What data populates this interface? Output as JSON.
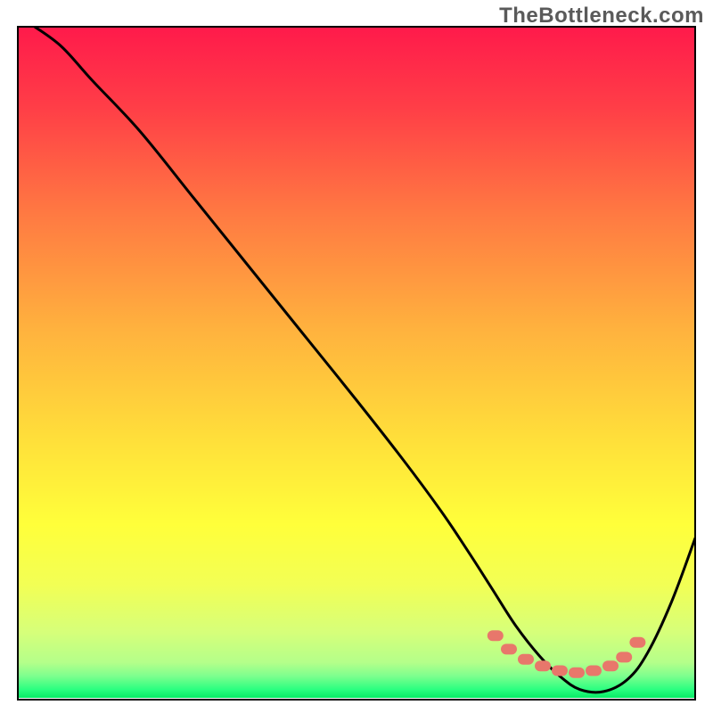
{
  "watermark": "TheBottleneck.com",
  "chart_data": {
    "type": "line",
    "title": "",
    "xlabel": "",
    "ylabel": "",
    "xlim": [
      0,
      100
    ],
    "ylim": [
      0,
      100
    ],
    "background_gradient": {
      "stops": [
        {
          "offset": 0.0,
          "color": "#ff1a4b"
        },
        {
          "offset": 0.12,
          "color": "#ff3e47"
        },
        {
          "offset": 0.28,
          "color": "#ff7a42"
        },
        {
          "offset": 0.45,
          "color": "#ffb23e"
        },
        {
          "offset": 0.62,
          "color": "#ffe13a"
        },
        {
          "offset": 0.74,
          "color": "#ffff3a"
        },
        {
          "offset": 0.83,
          "color": "#f2ff55"
        },
        {
          "offset": 0.9,
          "color": "#d6ff7a"
        },
        {
          "offset": 0.945,
          "color": "#b4ff8a"
        },
        {
          "offset": 0.965,
          "color": "#7dff8e"
        },
        {
          "offset": 0.985,
          "color": "#2bff80"
        },
        {
          "offset": 1.0,
          "color": "#00e860"
        }
      ]
    },
    "series": [
      {
        "name": "curve",
        "type": "line",
        "x": [
          2.5,
          6.5,
          11,
          18,
          26,
          34,
          42,
          50,
          57,
          62.5,
          66.5,
          70,
          73.5,
          77,
          80,
          83,
          86.5,
          90,
          93,
          96.5,
          100
        ],
        "y": [
          100,
          97,
          92,
          84.5,
          74.5,
          64.5,
          54.5,
          44.5,
          35.5,
          28,
          22,
          16.5,
          11,
          6.5,
          3.5,
          1.5,
          1.2,
          3,
          7,
          14.5,
          24
        ]
      },
      {
        "name": "bottom-markers",
        "type": "scatter",
        "x": [
          70.5,
          72.5,
          75,
          77.5,
          80,
          82.5,
          85,
          87.5,
          89.5,
          91.5
        ],
        "y": [
          9.5,
          7.5,
          6,
          5,
          4.3,
          4,
          4.3,
          5,
          6.3,
          8.5
        ]
      }
    ]
  }
}
